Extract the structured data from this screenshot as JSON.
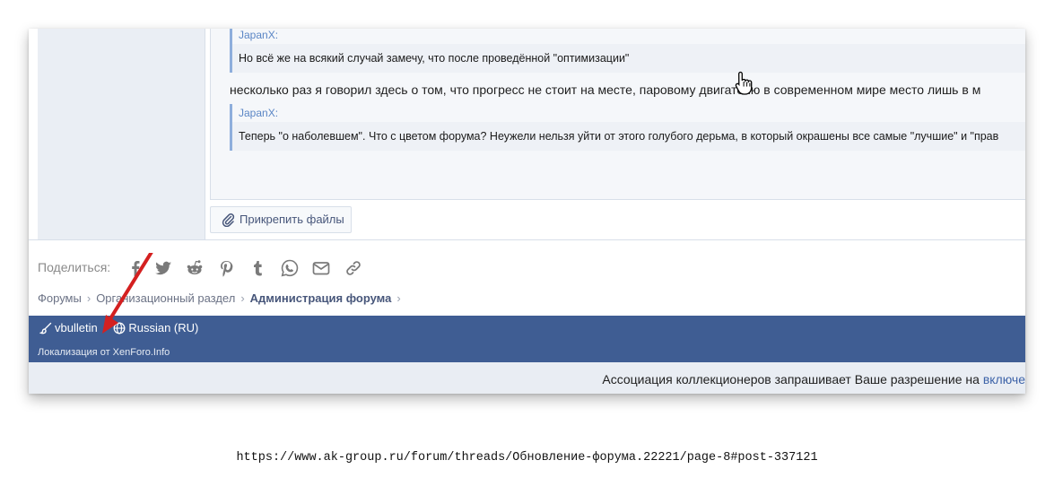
{
  "post": {
    "quote1_author": "JapanX:",
    "quote1_text": "Но всё же на всякий случай замечу, что после проведённой \"оптимизации\"",
    "message_text": "несколько раз я говорил здесь о том, что прогресс не стоит на месте, паровому двигателю в современном мире место лишь в м",
    "quote2_author": "JapanX:",
    "quote2_text": "Теперь \"о наболевшем\". Что с цветом форума? Неужели нельзя уйти от этого голубого дерьма, в который окрашены все самые \"лучшие\" и \"прав",
    "attach_label": "Прикрепить файлы"
  },
  "share": {
    "label": "Поделиться:",
    "icons": [
      "facebook-icon",
      "twitter-icon",
      "reddit-icon",
      "pinterest-icon",
      "tumblr-icon",
      "whatsapp-icon",
      "email-icon",
      "link-icon"
    ]
  },
  "breadcrumb": {
    "items": [
      "Форумы",
      "Организационный раздел",
      "Администрация форума"
    ]
  },
  "footer": {
    "style_label": "vbulletin",
    "language_label": "Russian (RU)",
    "localization_text": "Локализация от XenForo.Info"
  },
  "consent": {
    "text": "Ассоциация коллекционеров запрашивает Ваше разрешение на ",
    "link_text": "включе"
  },
  "caption": {
    "url": "https://www.ak-group.ru/forum/threads/Обновление-форума.22221/page-8#post-337121"
  },
  "colors": {
    "footer_bg": "#3f5d93",
    "quote_border": "#8eaedc",
    "arrow": "#d42020",
    "link": "#5b86c5"
  }
}
